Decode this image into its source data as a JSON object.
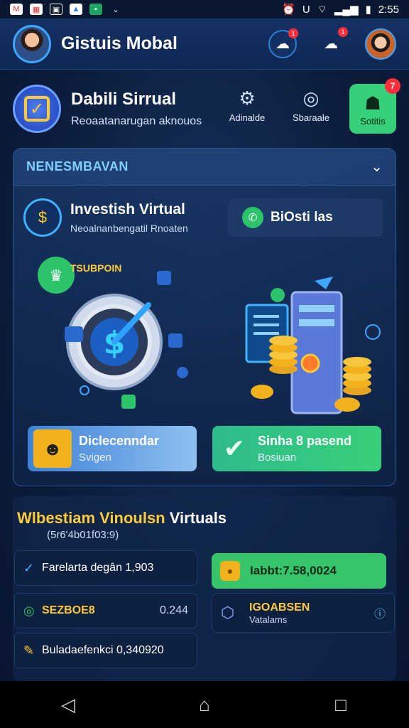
{
  "status_bar": {
    "time": "2:55",
    "left_icons": [
      "gmail-icon",
      "calendar-icon",
      "qr-icon",
      "photos-icon",
      "sheets-icon",
      "chevron-icon"
    ],
    "right_icons": [
      "alarm-icon",
      "magnet-icon",
      "wifi-icon",
      "signal-icon",
      "battery-icon"
    ]
  },
  "header": {
    "title": "Gistuis Mobal",
    "notification_count": "1",
    "message_count": "1"
  },
  "hero": {
    "title": "Dabili Sirrual",
    "subtitle": "Reoaatanarugan aknouos",
    "actions": [
      {
        "label": "Adinalde",
        "icon": "gear-icon"
      },
      {
        "label": "Sbaraale",
        "icon": "target-icon"
      },
      {
        "label": "Sotitis",
        "icon": "group-icon",
        "badge": "7"
      }
    ]
  },
  "card": {
    "header_title": "NENESMBAVAN",
    "feature_title": "Investish Virtual",
    "feature_sub": "Neoalnanbengatil Rnoaten",
    "feature_button": "BiOsti las",
    "illustration_label": "TSUBPOIN",
    "btn_left_title": "Diclecenndar",
    "btn_left_sub": "Svigen",
    "btn_right_title": "Sinha 8 pasend",
    "btn_right_sub": "Bosiuan"
  },
  "panel": {
    "title_yellow": "Wlbestiam Vinoulsn",
    "title_white": " Virtuals",
    "subtitle": "(5r6'4b01f03:9)",
    "rows": [
      {
        "label": "Farelarta degân 1,903",
        "icon": "check-icon"
      },
      {
        "label": "SEZBOE8",
        "value": "0.244",
        "icon": "circle-check-icon"
      },
      {
        "label": "Buladaefenkci 0,340920",
        "icon": "pencil-check-icon"
      }
    ],
    "right_rows": [
      {
        "label": "Iabbt:7.58,0024",
        "icon": "coin-icon"
      },
      {
        "label": "IGOABSEN",
        "sub": "Vatalams",
        "icon": "lock-icon"
      }
    ]
  }
}
